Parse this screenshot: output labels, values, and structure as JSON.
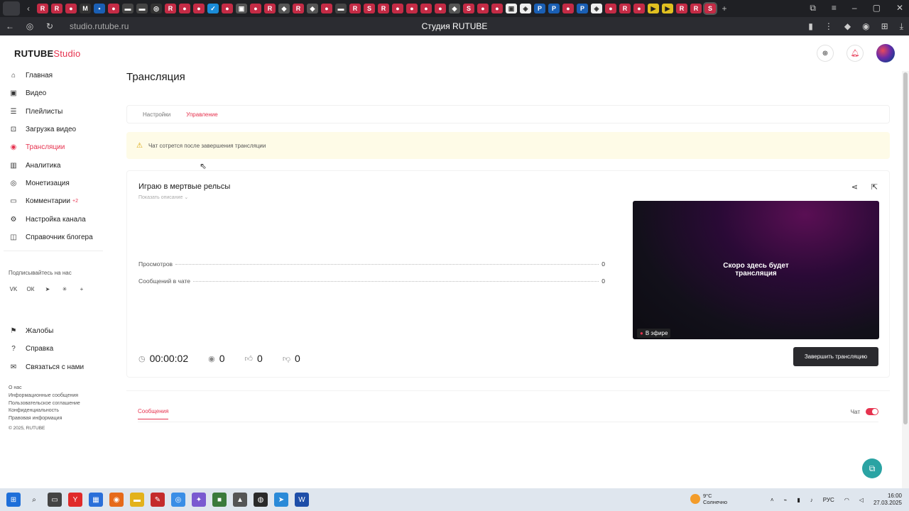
{
  "browser": {
    "url": "studio.rutube.ru",
    "page_title": "Студия RUTUBE"
  },
  "logo": {
    "main": "RUTUBE",
    "accent": "Studio"
  },
  "sidebar": {
    "items": [
      {
        "label": "Главная",
        "icon": "home-icon"
      },
      {
        "label": "Видео",
        "icon": "video-icon"
      },
      {
        "label": "Плейлисты",
        "icon": "list-icon"
      },
      {
        "label": "Загрузка видео",
        "icon": "upload-icon"
      },
      {
        "label": "Трансляции",
        "icon": "broadcast-icon",
        "active": true
      },
      {
        "label": "Аналитика",
        "icon": "analytics-icon"
      },
      {
        "label": "Монетизация",
        "icon": "money-icon"
      },
      {
        "label": "Комментарии",
        "icon": "comments-icon",
        "badge": "+2"
      },
      {
        "label": "Настройка канала",
        "icon": "gear-icon"
      },
      {
        "label": "Справочник блогера",
        "icon": "book-icon"
      }
    ],
    "subscribe_label": "Подписывайтесь на нас",
    "secondary": [
      {
        "label": "Жалобы",
        "icon": "flag-icon"
      },
      {
        "label": "Справка",
        "icon": "help-icon"
      },
      {
        "label": "Связаться с нами",
        "icon": "mail-icon"
      }
    ],
    "footer_links": [
      "О нас",
      "Информационные сообщения",
      "Пользовательское соглашение",
      "Конфиденциальность",
      "Правовая информация"
    ],
    "copyright": "© 2025, RUTUBE"
  },
  "main": {
    "title": "Трансляция",
    "tabs": [
      {
        "label": "Настройки",
        "active": false
      },
      {
        "label": "Управление",
        "active": true
      }
    ],
    "warning": "Чат сотрется после завершения трансляции",
    "stream": {
      "title": "Играю в мертвые рельсы",
      "show_description": "Показать описание",
      "stats": [
        {
          "label": "Просмотров",
          "value": "0"
        },
        {
          "label": "Сообщений в чате",
          "value": "0"
        }
      ],
      "duration": "00:00:02",
      "viewers": "0",
      "likes": "0",
      "dislikes": "0",
      "preview_text_line1": "Скоро здесь будет",
      "preview_text_line2": "трансляция",
      "live_label": "В эфире",
      "end_button": "Завершить трансляцию"
    },
    "messages": {
      "tab_label": "Сообщения",
      "chat_label": "Чат"
    }
  },
  "taskbar": {
    "weather_temp": "9°C",
    "weather_desc": "Солнечно",
    "lang": "РУС",
    "time": "16:00",
    "date": "27.03.2025"
  },
  "colors": {
    "accent": "#e6334f",
    "warning_bg": "#fefbe7",
    "button_dark": "#2a2a2e"
  }
}
